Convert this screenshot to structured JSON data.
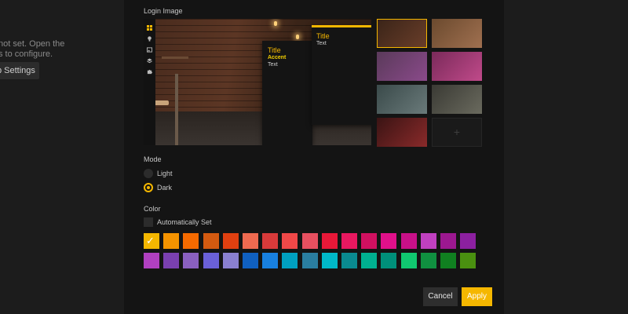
{
  "background_page": {
    "message": "not set. Open the s to configure.",
    "settings_button": "b Settings"
  },
  "login_image": {
    "label": "Login Image",
    "toolbar_icons": [
      "grid-icon",
      "bulb-icon",
      "image-icon",
      "layers-icon",
      "puzzle-icon"
    ],
    "preview_card_back": {
      "title": "Title",
      "accent": "Accent",
      "text": "Text"
    },
    "preview_card_front": {
      "title": "Title",
      "text": "Text"
    },
    "thumbnails": [
      {
        "selected": true,
        "colors": [
          "#3a2418",
          "#6a3e2a"
        ]
      },
      {
        "selected": false,
        "colors": [
          "#6b4a2e",
          "#a07050"
        ]
      },
      {
        "selected": false,
        "colors": [
          "#5a3a5a",
          "#8a4a8a"
        ]
      },
      {
        "selected": false,
        "colors": [
          "#7a2a5a",
          "#c04a8a"
        ]
      },
      {
        "selected": false,
        "colors": [
          "#3a4a4a",
          "#6a7a7a"
        ]
      },
      {
        "selected": false,
        "colors": [
          "#3a3a34",
          "#6a6a5e"
        ]
      },
      {
        "selected": false,
        "colors": [
          "#3a1414",
          "#8a2a2a"
        ]
      }
    ],
    "add_symbol": "+"
  },
  "mode": {
    "label": "Mode",
    "options": [
      {
        "label": "Light",
        "selected": false
      },
      {
        "label": "Dark",
        "selected": true
      }
    ]
  },
  "color": {
    "label": "Color",
    "auto_label": "Automatically Set",
    "selected_index": 0,
    "check_mark": "✓",
    "swatches": [
      "#f5b700",
      "#f59300",
      "#f56a00",
      "#d45a10",
      "#e04010",
      "#ef6a50",
      "#d83a3a",
      "#f04848",
      "#e85060",
      "#e81838",
      "#e81860",
      "#d01060",
      "#e0108a",
      "#c81088",
      "#c040c0",
      "#9c1890",
      "#8c20a0",
      "#b040c0",
      "#7a40b0",
      "#8a60c0",
      "#6a60d8",
      "#8a80d0",
      "#1060c0",
      "#1880e0",
      "#00a0c0",
      "#2a7ea0",
      "#00b8c8",
      "#0a8a90",
      "#00b090",
      "#00907a",
      "#10c870",
      "#109040",
      "#108020",
      "#4a9010"
    ]
  },
  "actions": {
    "cancel": "Cancel",
    "apply": "Apply"
  }
}
